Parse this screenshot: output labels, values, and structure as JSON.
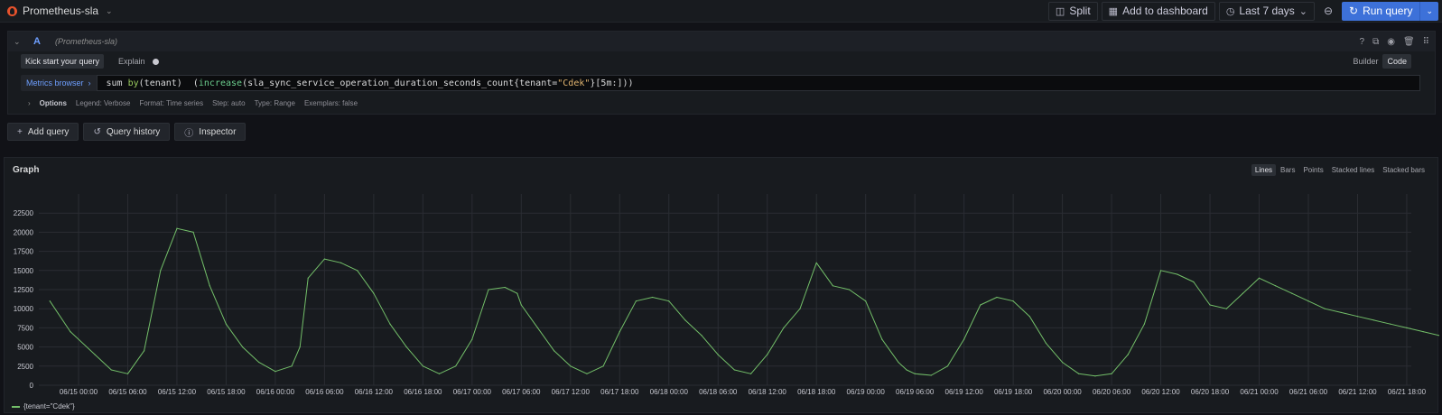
{
  "topbar": {
    "datasource": "Prometheus-sla",
    "split_label": "Split",
    "add_dashboard_label": "Add to dashboard",
    "time_range": "Last 7 days",
    "run_label": "Run query"
  },
  "query": {
    "letter": "A",
    "datasource_hint": "(Prometheus-sla)",
    "kick_start_label": "Kick start your query",
    "explain_label": "Explain",
    "builder_label": "Builder",
    "code_label": "Code",
    "metrics_browser_label": "Metrics browser",
    "expr_parts": {
      "p1": "sum ",
      "p2": "by",
      "p3": "(tenant)  (",
      "p4": "increase",
      "p5": "(sla_sync_service_operation_duration_seconds_count{tenant=",
      "p6": "\"Cdek\"",
      "p7": "}[5m:]))"
    },
    "options": {
      "label": "Options",
      "legend": "Legend: Verbose",
      "format": "Format: Time series",
      "step": "Step: auto",
      "type": "Type: Range",
      "exemplars": "Exemplars: false"
    }
  },
  "actions": {
    "add_query": "Add query",
    "query_history": "Query history",
    "inspector": "Inspector"
  },
  "graph": {
    "title": "Graph",
    "types": [
      "Lines",
      "Bars",
      "Points",
      "Stacked lines",
      "Stacked bars"
    ],
    "active_type": "Lines",
    "legend_label": "{tenant=\"Cdek\"}",
    "series_color": "#73bf69"
  },
  "chart_data": {
    "type": "line",
    "xlabel": "",
    "ylabel": "",
    "ylim": [
      0,
      25000
    ],
    "yticks": [
      0,
      2500,
      5000,
      7500,
      10000,
      12500,
      15000,
      17500,
      20000,
      22500
    ],
    "xticks": [
      "06/15 00:00",
      "06/15 06:00",
      "06/15 12:00",
      "06/15 18:00",
      "06/16 00:00",
      "06/16 06:00",
      "06/16 12:00",
      "06/16 18:00",
      "06/17 00:00",
      "06/17 06:00",
      "06/17 12:00",
      "06/17 18:00",
      "06/18 00:00",
      "06/18 06:00",
      "06/18 12:00",
      "06/18 18:00",
      "06/19 00:00",
      "06/19 06:00",
      "06/19 12:00",
      "06/19 18:00",
      "06/20 00:00",
      "06/20 06:00",
      "06/20 12:00",
      "06/20 18:00",
      "06/21 00:00",
      "06/21 06:00",
      "06/21 12:00",
      "06/21 18:00"
    ],
    "grid": true,
    "series": [
      {
        "name": "{tenant=\"Cdek\"}",
        "x_hours": [
          -3.5,
          -1,
          2,
          4,
          6,
          8,
          10,
          12,
          14,
          16,
          18,
          20,
          22,
          24,
          26,
          27,
          28,
          30,
          32,
          34,
          36,
          38,
          40,
          42,
          44,
          46,
          48,
          50,
          52,
          53.5,
          54,
          56,
          58,
          60,
          62,
          64,
          66,
          68,
          70,
          72,
          74,
          76,
          78,
          80,
          82,
          84,
          86,
          88,
          90,
          92,
          94,
          96,
          98,
          100,
          101,
          102,
          104,
          106,
          108,
          110,
          112,
          114,
          116,
          118,
          120,
          122,
          124,
          126,
          128,
          130,
          132,
          134,
          136,
          138,
          140,
          142,
          144,
          146,
          148,
          150,
          152,
          154,
          156,
          158,
          160,
          162,
          164,
          166,
          168
        ],
        "values": [
          11000,
          7000,
          4000,
          2000,
          1500,
          4500,
          15000,
          20500,
          20000,
          13000,
          8000,
          5000,
          3000,
          1800,
          2500,
          5000,
          14000,
          16500,
          16000,
          15000,
          12000,
          8000,
          5000,
          2500,
          1500,
          2500,
          6000,
          12500,
          12800,
          12000,
          10500,
          7500,
          4500,
          2500,
          1500,
          2500,
          7000,
          11000,
          11500,
          11000,
          8500,
          6500,
          4000,
          2000,
          1500,
          4000,
          7500,
          10000,
          16000,
          13000,
          12500,
          11000,
          6000,
          3000,
          2000,
          1500,
          1300,
          2500,
          6000,
          10500,
          11500,
          11000,
          9000,
          5500,
          3000,
          1500,
          1200,
          1500,
          4000,
          8000,
          15000,
          14500,
          13500,
          10500,
          10000,
          12000,
          14000,
          13000,
          12000,
          11000,
          10000,
          9500,
          9000,
          8500,
          8000,
          7500,
          7000,
          6500,
          6000
        ]
      }
    ]
  }
}
